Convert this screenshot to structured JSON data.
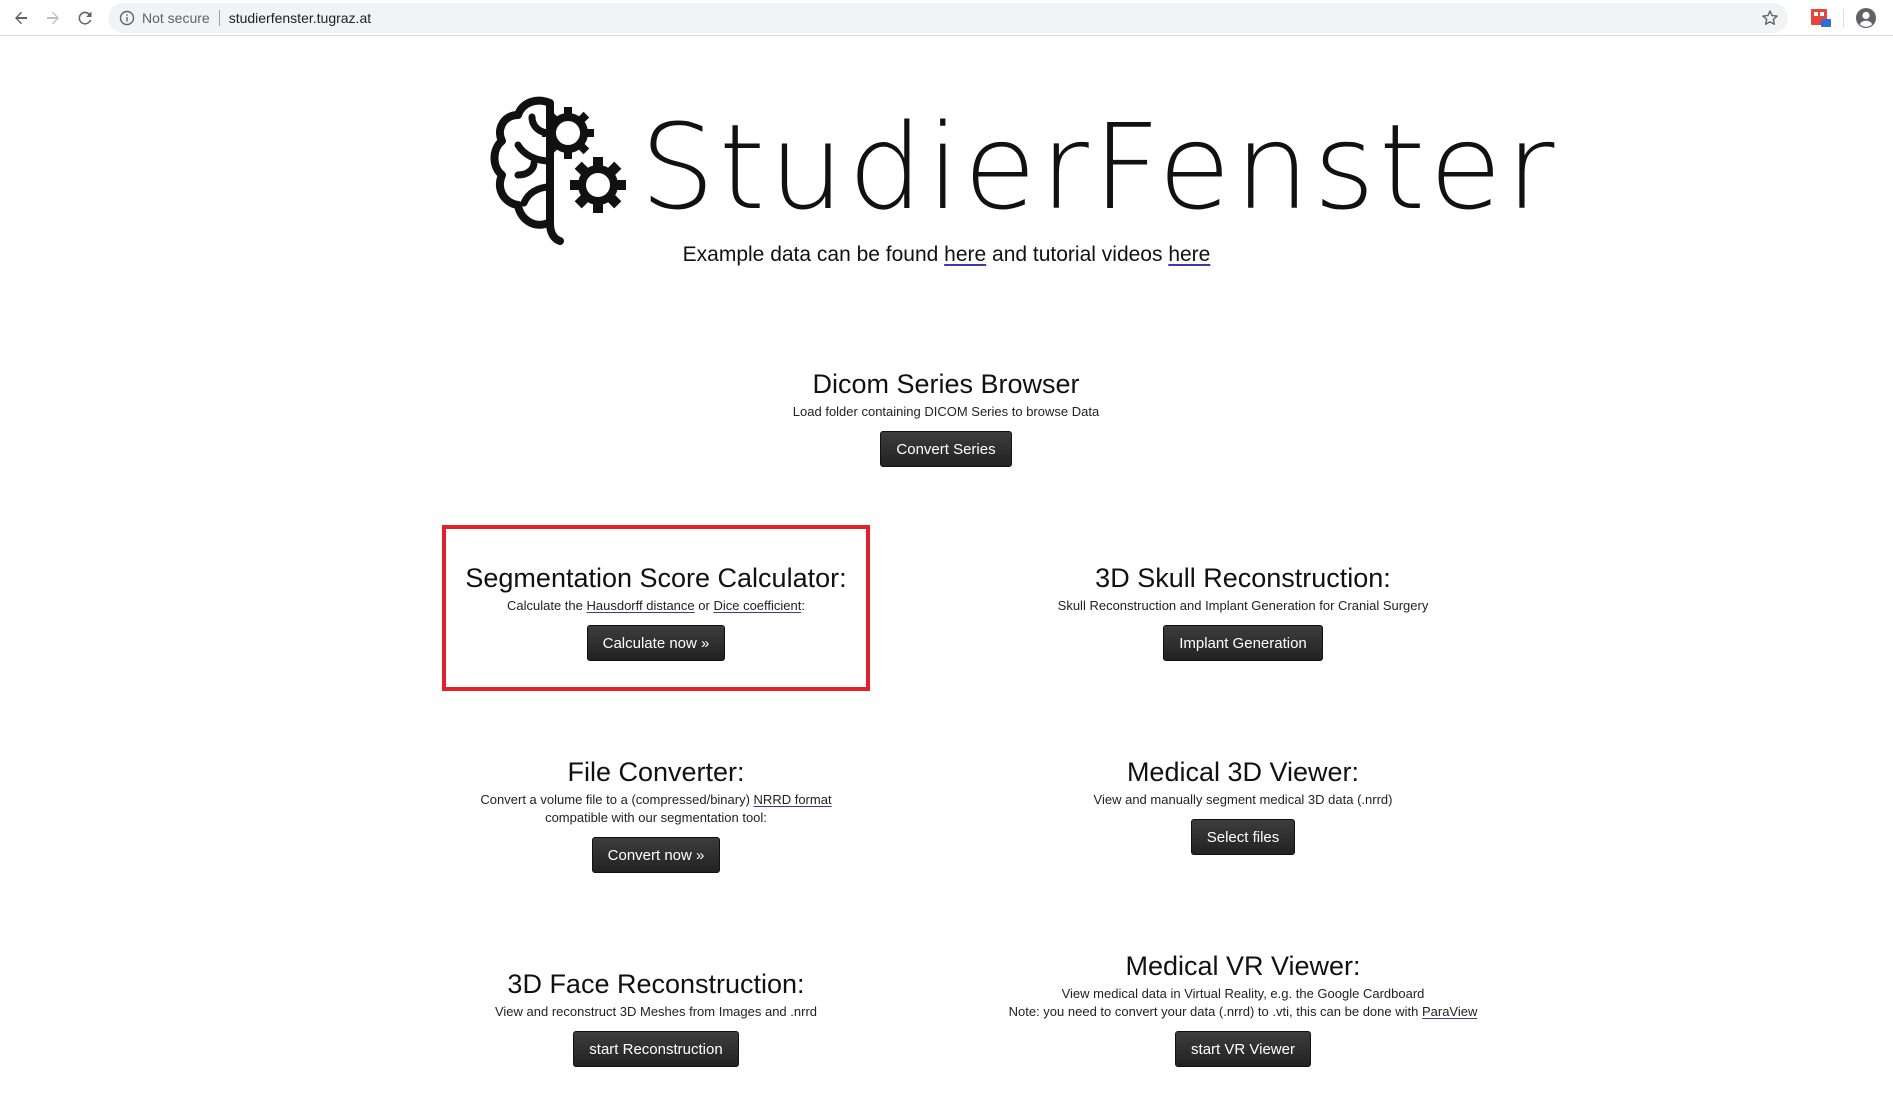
{
  "browser": {
    "security_label": "Not secure",
    "url": "studierfenster.tugraz.at"
  },
  "colors": {
    "button_bg": "#2b2b2b",
    "highlight": "#e3202d",
    "link_underline": "#3a3aa8"
  },
  "header": {
    "logo_text": "StudierFenster",
    "intro_prefix": "Example data can be found ",
    "intro_link1": "here",
    "intro_middle": " and tutorial videos ",
    "intro_link2": "here"
  },
  "sections": {
    "dicom": {
      "title": "Dicom Series Browser",
      "desc": "Load folder containing DICOM Series to browse Data",
      "button": "Convert Series"
    },
    "segmentation": {
      "title": "Segmentation Score Calculator:",
      "desc_prefix": "Calculate the ",
      "link_hausdorff": "Hausdorff distance",
      "desc_or": " or ",
      "link_dice": "Dice coefficient",
      "desc_suffix": ":",
      "button": "Calculate now »"
    },
    "skull": {
      "title": "3D Skull Reconstruction:",
      "desc": "Skull Reconstruction and Implant Generation for Cranial Surgery",
      "button": "Implant Generation"
    },
    "converter": {
      "title": "File Converter:",
      "desc_prefix": "Convert a volume file to a (compressed/binary) ",
      "link_nrrd": "NRRD format",
      "desc_line2": "compatible with our segmentation tool:",
      "button": "Convert now »"
    },
    "viewer3d": {
      "title": "Medical 3D Viewer:",
      "desc": "View and manually segment medical 3D data (.nrrd)",
      "button": "Select files"
    },
    "face": {
      "title": "3D Face Reconstruction:",
      "desc": "View and reconstruct 3D Meshes from Images and .nrrd",
      "button": "start Reconstruction"
    },
    "vr": {
      "title": "Medical VR Viewer:",
      "desc_line1": "View medical data in Virtual Reality, e.g. the Google Cardboard",
      "desc_line2_prefix": "Note: you need to convert your data (.nrrd) to .vti, this can be done with ",
      "link_paraview": "ParaView",
      "button": "start VR Viewer"
    }
  }
}
